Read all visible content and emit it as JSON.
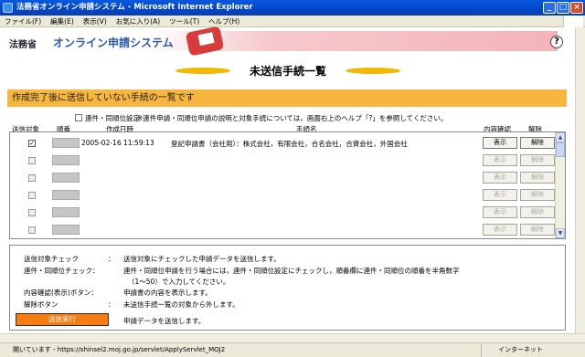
{
  "window": {
    "title": "法務省オンライン申請システム - Microsoft Internet Explorer",
    "minimize": "_",
    "maximize": "□",
    "close": "×"
  },
  "menu": [
    "ファイル(F)",
    "編集(E)",
    "表示(V)",
    "お気に入り(A)",
    "ツール(T)",
    "ヘルプ(H)"
  ],
  "header": {
    "ministry": "法務省",
    "system": "オンライン申請システム",
    "help": "?"
  },
  "page": {
    "title": "未送信手続一覧",
    "subtitle": "作成完了後に送信していない手続の一覧です"
  },
  "options": {
    "link_setting": "連件・同順位設定",
    "note": "※連件申請・同順位申請の説明と対象手続については，画面右上のヘルプ「?」を参照してください。"
  },
  "columns": {
    "send": "送信対象",
    "order": "順番",
    "created": "作成日時",
    "procedure": "手続名",
    "confirm": "内容確認",
    "cancel": "解除"
  },
  "rows": [
    {
      "checked": true,
      "date": "2005-02-16 11:59:13",
      "name": "登記申請書（会社用）：株式会社，有限会社，合名会社，合資会社，外国会社",
      "view": "表示",
      "cancel": "解除",
      "active": true
    },
    {
      "checked": false,
      "date": "",
      "name": "",
      "view": "表示",
      "cancel": "解除",
      "active": false
    },
    {
      "checked": false,
      "date": "",
      "name": "",
      "view": "表示",
      "cancel": "解除",
      "active": false
    },
    {
      "checked": false,
      "date": "",
      "name": "",
      "view": "表示",
      "cancel": "解除",
      "active": false
    },
    {
      "checked": false,
      "date": "",
      "name": "",
      "view": "表示",
      "cancel": "解除",
      "active": false
    },
    {
      "checked": false,
      "date": "",
      "name": "",
      "view": "表示",
      "cancel": "解除",
      "active": false
    }
  ],
  "help": {
    "l1a": "送信対象チェック",
    "l1b": "：",
    "l1c": "送信対象にチェックした申請データを送信します。",
    "l2a": "連件・同順位チェック：",
    "l2c": "連件・同順位申請を行う場合には，連件・同順位設定にチェックし，順番欄に連件・同順位の順番を半角数字",
    "l2d": "（1～50）で入力してください。",
    "l3a": "内容確認(表示)ボタン：",
    "l3c": "申請書の内容を表示します。",
    "l4a": "解除ボタン",
    "l4b": "：",
    "l4c": "未送信手続一覧の対象から外します。",
    "send_button": "送信実行",
    "send_desc": "申請データを送信します。"
  },
  "status": {
    "text": "開いています - https://shinsei2.moj.go.jp/servlet/ApplyServlet_MOJ2",
    "zone": "インターネット"
  },
  "icons": {
    "help": "help-icon",
    "scroll_up": "up-arrow-icon",
    "scroll_down": "down-arrow-icon"
  }
}
